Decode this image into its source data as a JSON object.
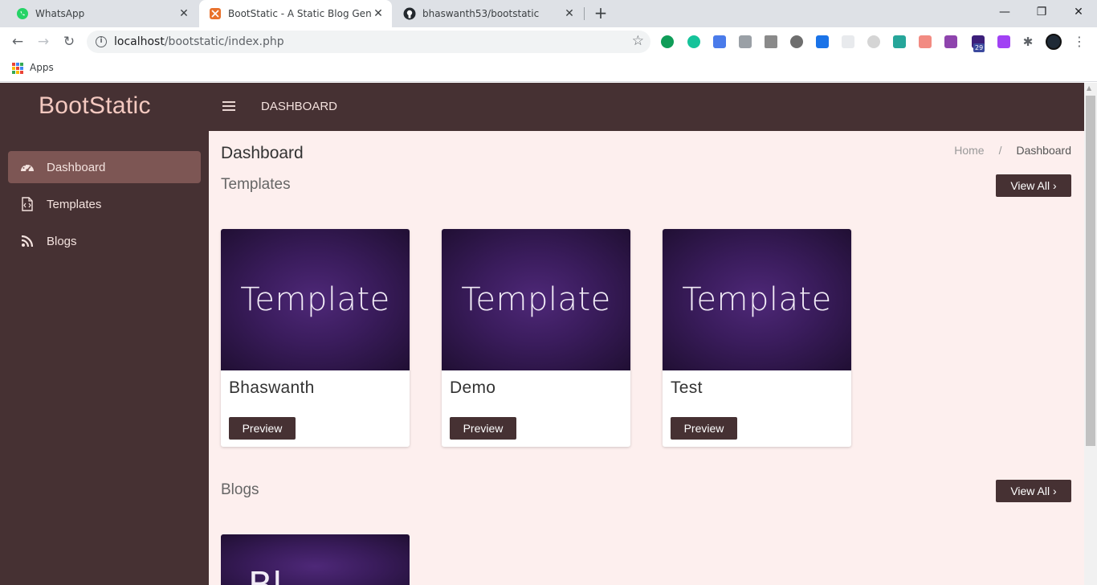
{
  "browser": {
    "tabs": [
      {
        "title": "WhatsApp"
      },
      {
        "title": "BootStatic - A Static Blog Genera"
      },
      {
        "title": "bhaswanth53/bootstatic"
      }
    ],
    "new_tab": "+",
    "url_host": "localhost",
    "url_path": "/bootstatic/index.php",
    "extension_badge": "29",
    "bookmarks": {
      "apps_label": "Apps"
    },
    "colors": {
      "tab_strip": "#dee1e6",
      "omnibox": "#f1f3f4"
    }
  },
  "app": {
    "brand": "BootStatic",
    "topnav_title": "DASHBOARD",
    "sidebar": {
      "items": [
        {
          "label": "Dashboard",
          "icon": "dashboard-gauge-icon",
          "active": true
        },
        {
          "label": "Templates",
          "icon": "file-code-icon",
          "active": false
        },
        {
          "label": "Blogs",
          "icon": "rss-icon",
          "active": false
        }
      ]
    },
    "page_title": "Dashboard",
    "breadcrumb": {
      "home": "Home",
      "separator": "/",
      "current": "Dashboard"
    },
    "templates": {
      "title": "Templates",
      "view_all": "View All ›",
      "cards": [
        {
          "image_text": "Template",
          "name": "Bhaswanth",
          "button": "Preview"
        },
        {
          "image_text": "Template",
          "name": "Demo",
          "button": "Preview"
        },
        {
          "image_text": "Template",
          "name": "Test",
          "button": "Preview"
        }
      ]
    },
    "blogs": {
      "title": "Blogs",
      "view_all": "View All ›",
      "cards": [
        {
          "image_text": "Bl"
        }
      ]
    },
    "colors": {
      "primary_dark": "#463133",
      "active_item": "#7d5654",
      "content_bg": "#fdefee",
      "brand_text": "#f4c9c0"
    }
  }
}
